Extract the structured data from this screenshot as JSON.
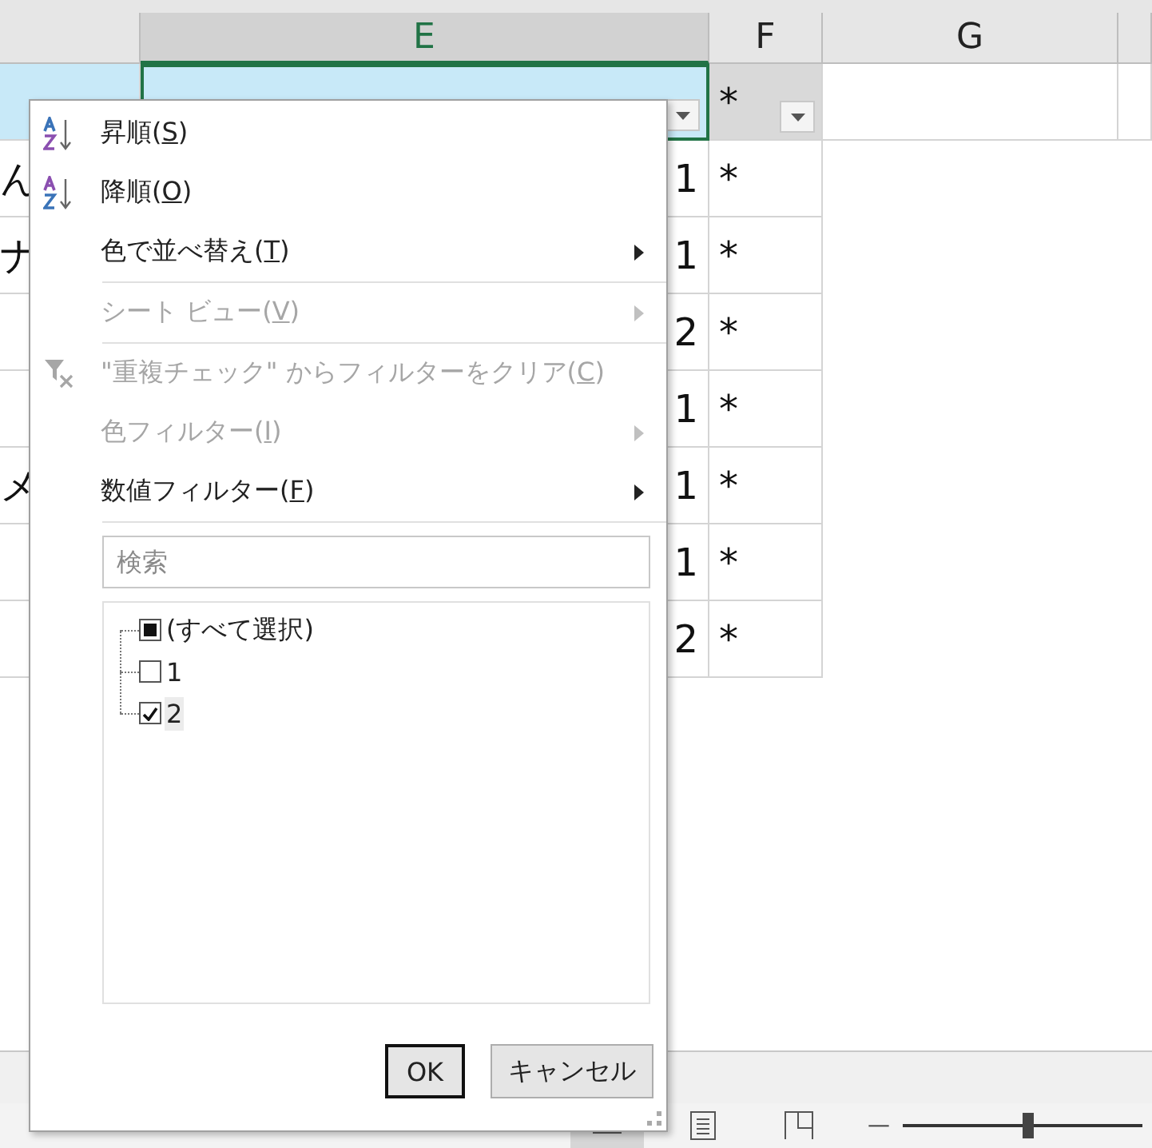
{
  "columns": [
    {
      "selected": false
    },
    {
      "label": "E",
      "selected": true
    },
    {
      "label": "F",
      "selected": false
    },
    {
      "label": "G",
      "selected": false
    },
    {
      "selected": false
    }
  ],
  "header_row": {
    "column_f": "*"
  },
  "rows": [
    {
      "column_d": "ん",
      "column_e": "1",
      "column_f": "*"
    },
    {
      "column_d": "ナ",
      "column_e": "1",
      "column_f": "*"
    },
    {
      "column_e": "2",
      "column_f": "*"
    },
    {
      "column_e": "1",
      "column_f": "*"
    },
    {
      "column_d": "メ",
      "column_e": "1",
      "column_f": "*"
    },
    {
      "column_e": "1",
      "column_f": "*"
    },
    {
      "column_e": "2",
      "column_f": "*"
    }
  ],
  "filter_menu": {
    "items": [
      {
        "kind": "sort-ascending",
        "before": "昇順(",
        "accel": "S",
        "after": ")",
        "disabled": false,
        "submenu": false,
        "separator_after": false
      },
      {
        "kind": "sort-descending",
        "before": "降順(",
        "accel": "O",
        "after": ")",
        "disabled": false,
        "submenu": false,
        "separator_after": false
      },
      {
        "kind": "plain",
        "before": "色で並べ替え(",
        "accel": "T",
        "after": ")",
        "disabled": false,
        "submenu": true,
        "separator_after": true
      },
      {
        "kind": "plain",
        "before": "シート ビュー(",
        "accel": "V",
        "after": ")",
        "disabled": true,
        "submenu": true,
        "separator_after": true
      },
      {
        "kind": "filter-clear",
        "before": "\"重複チェック\" からフィルターをクリア(",
        "accel": "C",
        "after": ")",
        "disabled": true,
        "submenu": false,
        "separator_after": false
      },
      {
        "kind": "plain",
        "before": "色フィルター(",
        "accel": "I",
        "after": ")",
        "disabled": true,
        "submenu": true,
        "separator_after": false
      },
      {
        "kind": "plain",
        "before": "数値フィルター(",
        "accel": "F",
        "after": ")",
        "disabled": false,
        "submenu": true,
        "separator_after": true
      }
    ],
    "search": {
      "placeholder": "検索"
    },
    "values": [
      {
        "label": "(すべて選択)",
        "indeterminate": true,
        "selected": false
      },
      {
        "label": "1",
        "checked": false,
        "selected": false
      },
      {
        "label": "2",
        "checked": true,
        "selected": true
      }
    ],
    "buttons": [
      {
        "label": "OK",
        "default": true
      },
      {
        "label": "キャンセル",
        "default": false
      }
    ]
  },
  "status_bar": {
    "views": [
      {
        "kind": "normal",
        "selected": true
      },
      {
        "kind": "page-layout",
        "selected": false
      },
      {
        "kind": "page-break",
        "selected": false
      }
    ],
    "zoom_minus": "—",
    "zoom": {
      "level": 0.52
    }
  }
}
